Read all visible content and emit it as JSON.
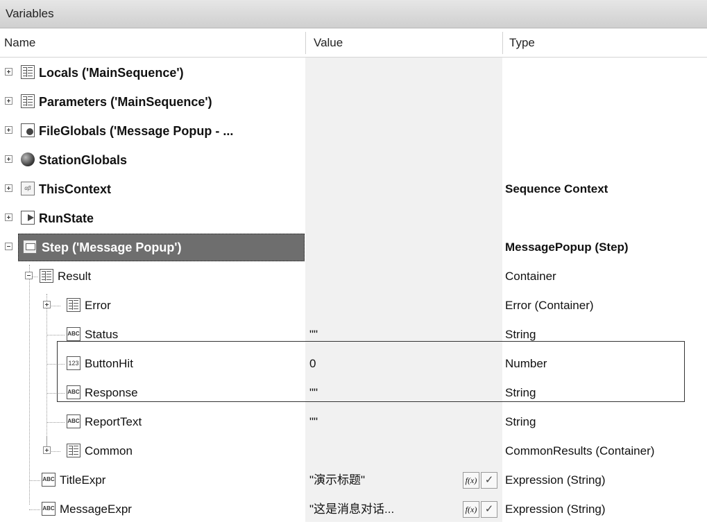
{
  "panel": {
    "title": "Variables"
  },
  "columns": {
    "name": "Name",
    "value": "Value",
    "type": "Type"
  },
  "rows": [
    {
      "label": "Locals ('MainSequence')",
      "value": "",
      "type": "",
      "icon": "locals-icon"
    },
    {
      "label": "Parameters ('MainSequence')",
      "value": "",
      "type": "",
      "icon": "parameters-icon"
    },
    {
      "label": "FileGlobals ('Message Popup - ...",
      "value": "",
      "type": "",
      "icon": "fileglobals-icon"
    },
    {
      "label": "StationGlobals",
      "value": "",
      "type": "",
      "icon": "globe-icon"
    },
    {
      "label": "ThisContext",
      "value": "",
      "type": "Sequence Context",
      "icon": "context-icon"
    },
    {
      "label": "RunState",
      "value": "",
      "type": "",
      "icon": "runstate-icon"
    },
    {
      "label": "Step ('Message Popup')",
      "value": "",
      "type": "MessagePopup (Step)",
      "icon": "step-icon"
    },
    {
      "label": "Result",
      "value": "",
      "type": "Container",
      "icon": "container-icon"
    },
    {
      "label": "Error",
      "value": "",
      "type": "Error (Container)",
      "icon": "container-icon"
    },
    {
      "label": "Status",
      "value": "\"\"",
      "type": "String",
      "icon": "string-icon"
    },
    {
      "label": "ButtonHit",
      "value": "0",
      "type": "Number",
      "icon": "number-icon"
    },
    {
      "label": "Response",
      "value": "\"\"",
      "type": "String",
      "icon": "string-icon"
    },
    {
      "label": "ReportText",
      "value": "\"\"",
      "type": "String",
      "icon": "string-icon"
    },
    {
      "label": "Common",
      "value": "",
      "type": "CommonResults (Container)",
      "icon": "container-icon"
    },
    {
      "label": "TitleExpr",
      "value": "\"演示标题\"",
      "type": "Expression (String)",
      "icon": "string-icon"
    },
    {
      "label": "MessageExpr",
      "value": "\"这是消息对话...",
      "type": "Expression (String)",
      "icon": "string-icon"
    }
  ],
  "buttons": {
    "fx": "f(x)",
    "check": "✓"
  },
  "colors": {
    "selection": "#6e6e6e",
    "value_column": "#f1f1f1"
  }
}
